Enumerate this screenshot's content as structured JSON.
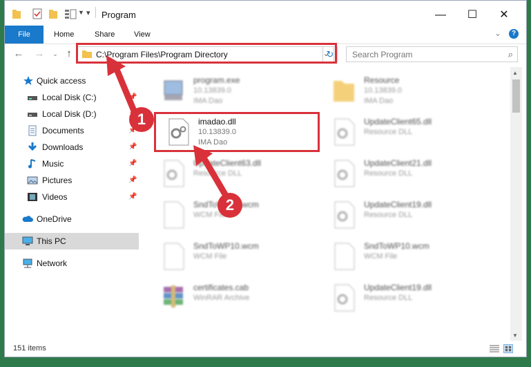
{
  "window": {
    "title": "Program"
  },
  "ribbon": {
    "tabs": [
      "File",
      "Home",
      "Share",
      "View"
    ]
  },
  "address": {
    "path": "C:\\Program Files\\Program Directory"
  },
  "search": {
    "placeholder": "Search Program"
  },
  "sidebar": {
    "items": [
      {
        "label": "Quick access",
        "icon": "star-icon"
      },
      {
        "label": "Local Disk (C:)",
        "icon": "drive-icon"
      },
      {
        "label": "Local Disk (D:)",
        "icon": "drive-icon"
      },
      {
        "label": "Documents",
        "icon": "documents-icon"
      },
      {
        "label": "Downloads",
        "icon": "download-icon"
      },
      {
        "label": "Music",
        "icon": "music-icon"
      },
      {
        "label": "Pictures",
        "icon": "pictures-icon"
      },
      {
        "label": "Videos",
        "icon": "videos-icon"
      },
      {
        "label": "OneDrive",
        "icon": "cloud-icon"
      },
      {
        "label": "This PC",
        "icon": "computer-icon"
      },
      {
        "label": "Network",
        "icon": "network-icon"
      }
    ]
  },
  "files": [
    {
      "name": "program.exe",
      "line1": "10.13839.0",
      "line2": "IMA Dao",
      "icon": "exe-icon"
    },
    {
      "name": "Resource",
      "line1": "10.13839.0",
      "line2": "IMA Dao",
      "icon": "folder-icon"
    },
    {
      "name": "imadao.dll",
      "line1": "10.13839.0",
      "line2": "IMA Dao",
      "icon": "dll-gear-icon"
    },
    {
      "name": "UpdateClient65.dll",
      "line1": "Resource DLL",
      "line2": "",
      "icon": "dll-gear-icon"
    },
    {
      "name": "UpdateClient63.dll",
      "line1": "Resource DLL",
      "line2": "",
      "icon": "dll-gear-icon"
    },
    {
      "name": "UpdateClient21.dll",
      "line1": "Resource DLL",
      "line2": "",
      "icon": "dll-gear-icon"
    },
    {
      "name": "SndToWP10.wcm",
      "line1": "WCM File",
      "line2": "",
      "icon": "blank-file-icon"
    },
    {
      "name": "UpdateClient19.dll",
      "line1": "Resource DLL",
      "line2": "",
      "icon": "dll-gear-icon"
    },
    {
      "name": "SndToWP10.wcm",
      "line1": "WCM File",
      "line2": "",
      "icon": "blank-file-icon"
    },
    {
      "name": "SndToWP10.wcm",
      "line1": "WCM File",
      "line2": "",
      "icon": "blank-file-icon"
    },
    {
      "name": "certificates.cab",
      "line1": "WinRAR Archive",
      "line2": "",
      "icon": "archive-icon"
    },
    {
      "name": "UpdateClient19.dll",
      "line1": "Resource DLL",
      "line2": "",
      "icon": "dll-gear-icon"
    }
  ],
  "status": {
    "count": "151 items"
  },
  "annotations": {
    "step1": "1",
    "step2": "2"
  },
  "colors": {
    "accent": "#1979ca",
    "highlight": "#d9313a",
    "folder": "#f2c14e"
  }
}
